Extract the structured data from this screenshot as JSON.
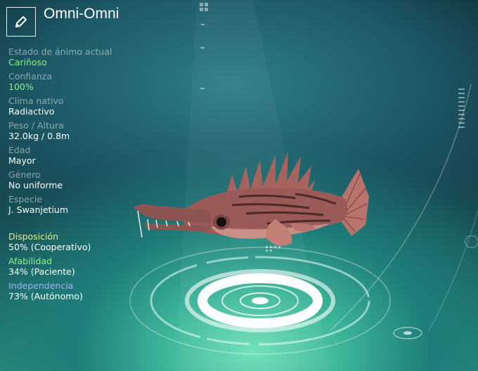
{
  "creature": {
    "name": "Omni-Omni"
  },
  "icons": {
    "edit": "pencil-icon"
  },
  "stats": [
    {
      "label": "Estado de ánimo actual",
      "value": "Cariñoso",
      "highlight": true
    },
    {
      "label": "Confianza",
      "value": "100%",
      "highlight": true
    },
    {
      "label": "Clima nativo",
      "value": "Radiactivo",
      "highlight": false
    },
    {
      "label": "Peso / Altura",
      "value": "32.0kg / 0.8m",
      "highlight": false
    },
    {
      "label": "Edad",
      "value": "Mayor",
      "highlight": false
    },
    {
      "label": "Género",
      "value": "No uniforme",
      "highlight": false
    },
    {
      "label": "Especie",
      "value": "J. Swanjetium",
      "highlight": false
    }
  ],
  "traits": [
    {
      "label": "Disposición",
      "value": "50% (Cooperativo)",
      "color": "#e8ec84"
    },
    {
      "label": "Afabilidad",
      "value": "34% (Paciente)",
      "color": "#8ff08c"
    },
    {
      "label": "Independencia",
      "value": "73% (Autónomo)",
      "color": "#9eb6f2"
    }
  ],
  "colors": {
    "highlight": "#8cf08a",
    "platform": "#ffffff"
  }
}
